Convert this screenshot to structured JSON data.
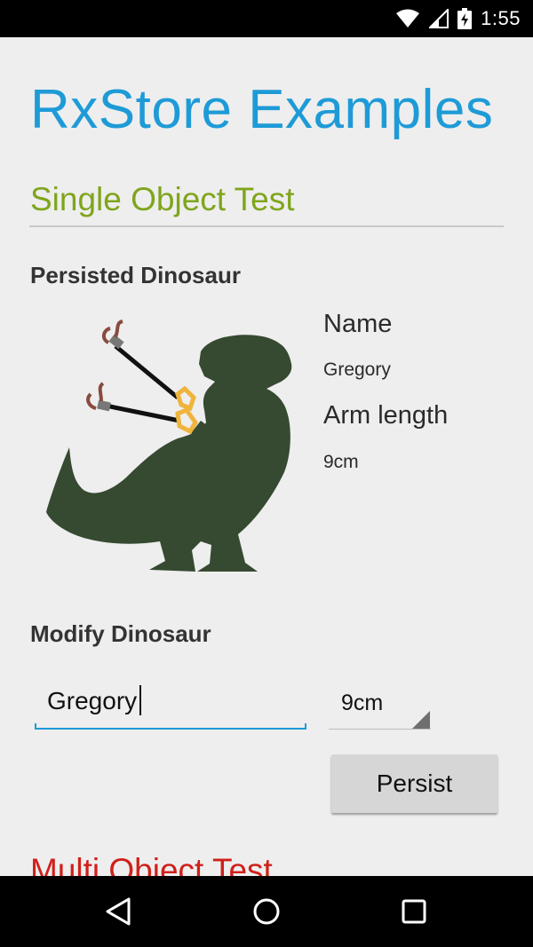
{
  "status_bar": {
    "time": "1:55",
    "icons": [
      "wifi-icon",
      "signal-icon",
      "battery-charging-icon"
    ]
  },
  "app": {
    "title": "RxStore Examples"
  },
  "single_object_test": {
    "title": "Single Object Test",
    "persisted_heading": "Persisted Dinosaur",
    "image": "tyrannosaurus-with-grabber-arms",
    "name_label": "Name",
    "name_value": "Gregory",
    "arm_label": "Arm length",
    "arm_value": "9cm"
  },
  "modify": {
    "heading": "Modify Dinosaur",
    "name_input_value": "Gregory",
    "arm_selected": "9cm",
    "persist_label": "Persist"
  },
  "multi_object_test": {
    "title": "Multi Object Test"
  },
  "navigation": {
    "buttons": [
      "back-icon",
      "home-icon",
      "recents-icon"
    ]
  },
  "colors": {
    "title": "#1e9bd7",
    "single_section": "#7fa51c",
    "multi_section": "#d0201a",
    "background": "#eeeeee",
    "dinosaur": "#354a30",
    "grabber_claw": "#f0b43c"
  }
}
